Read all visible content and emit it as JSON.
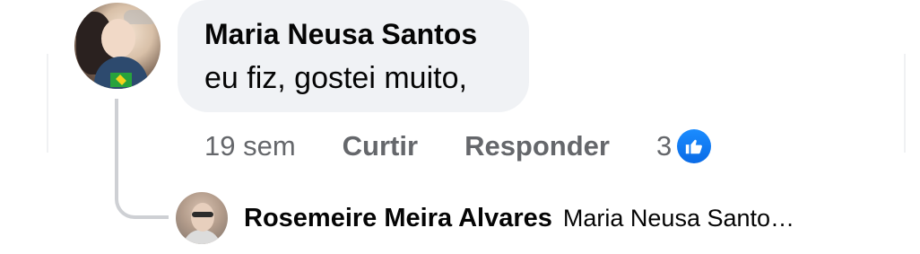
{
  "comment": {
    "author": "Maria Neusa Santos",
    "text": "eu fiz, gostei muito,",
    "time": "19 sem",
    "like_label": "Curtir",
    "reply_label": "Responder",
    "reaction_count": "3",
    "reaction_icon": "thumbs-up-icon",
    "reaction_color": "#1877f2"
  },
  "reply": {
    "author": "Rosemeire Meira Alvares",
    "preview": "Maria Neusa Santo…"
  },
  "colors": {
    "bubble_bg": "#f0f2f5",
    "secondary_text": "#65676b",
    "primary_text": "#050505",
    "thread_line": "#ced0d4"
  }
}
